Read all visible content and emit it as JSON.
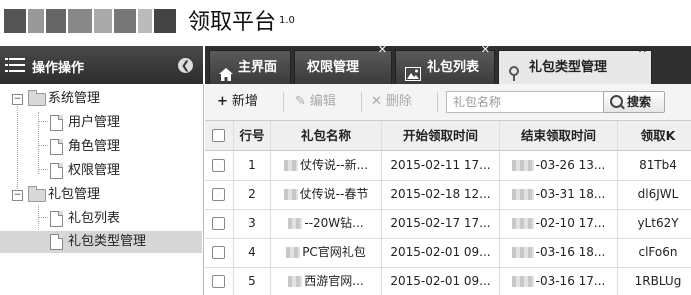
{
  "header": {
    "app_title": "领取平台",
    "version": "1.0"
  },
  "left": {
    "title": "操作操作",
    "tree": [
      {
        "label": "系统管理",
        "type": "folder",
        "children": [
          "用户管理",
          "角色管理",
          "权限管理"
        ]
      },
      {
        "label": "礼包管理",
        "type": "folder",
        "children": [
          "礼包列表",
          "礼包类型管理"
        ]
      }
    ],
    "selected": "礼包类型管理"
  },
  "tabs": [
    {
      "label": "主界面",
      "icon": "home-icon",
      "closable": false,
      "active": false
    },
    {
      "label": "权限管理",
      "icon": "",
      "closable": true,
      "active": false
    },
    {
      "label": "礼包列表",
      "icon": "picture-icon",
      "closable": true,
      "active": false
    },
    {
      "label": "礼包类型管理",
      "icon": "pin-icon",
      "closable": true,
      "active": true
    }
  ],
  "toolbar": {
    "add": "新增",
    "edit": "编辑",
    "delete": "删除",
    "search_placeholder": "礼包名称",
    "search_button": "搜索"
  },
  "grid": {
    "columns": [
      "行号",
      "礼包名称",
      "开始领取时间",
      "结束领取时间",
      "领取K"
    ],
    "rows": [
      {
        "no": "1",
        "name": "仗传说--新...",
        "start": "2015-02-11 17...",
        "end": "-03-26 13...",
        "key": "81Tb4"
      },
      {
        "no": "2",
        "name": "仗传说--春节",
        "start": "2015-02-18 12...",
        "end": "-03-31 18...",
        "key": "dl6JWL"
      },
      {
        "no": "3",
        "name": "--20W钻...",
        "start": "2015-02-17 17...",
        "end": "-02-10 17...",
        "key": "yLt62Y"
      },
      {
        "no": "4",
        "name": "PC官网礼包",
        "start": "2015-02-01 09...",
        "end": "-03-16 18...",
        "key": "clFo6n"
      },
      {
        "no": "5",
        "name": "西游官网...",
        "start": "2015-02-01 09...",
        "end": "-03-16 17...",
        "key": "1RBLUg"
      }
    ]
  },
  "colors": {
    "panel_header": "#2c2c2c",
    "tab_active": "#e8e8e8",
    "tree_selected": "#d6d6d6"
  }
}
